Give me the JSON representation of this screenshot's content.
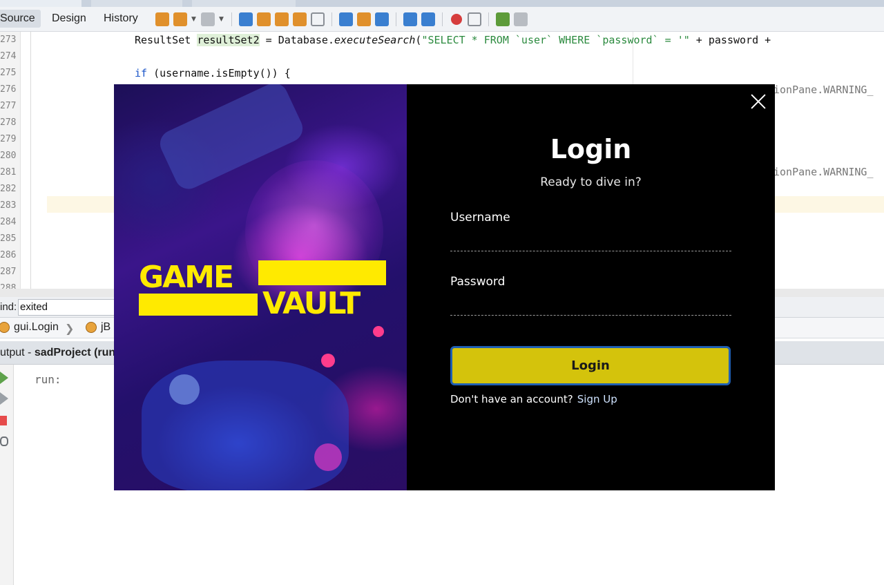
{
  "ide": {
    "tabs": [
      "Source",
      "Design",
      "History"
    ],
    "editor": {
      "line_numbers": [
        "273",
        "274",
        "275",
        "276",
        "277",
        "278",
        "279",
        "280",
        "281",
        "282",
        "283",
        "284",
        "285",
        "286",
        "287",
        "288"
      ],
      "line_273": {
        "type": "ResultSet ",
        "var": "resultSet2",
        "assign": " = Database.",
        "method": "executeSearch",
        "open": "(",
        "str1": "\"SELECT * FROM `user` WHERE `password` = '\"",
        "rest": " + password +"
      },
      "line_275": {
        "kw": "if",
        "rest": " (username.isEmpty()) {"
      },
      "ghost_276": "ionPane.WARNING_",
      "ghost_281": "ionPane.WARNING_"
    },
    "find": {
      "label": "ind:",
      "value": "exited"
    },
    "navigator": {
      "item1": "gui.Login",
      "item2": "jB"
    },
    "output": {
      "prefix": "utput - ",
      "project": "sadProject (run",
      "text": "run:"
    }
  },
  "dialog": {
    "brand": {
      "word1": "GAME",
      "word2": "VAULT"
    },
    "title": "Login",
    "subtitle": "Ready to dive in?",
    "username_label": "Username",
    "username_value": "",
    "password_label": "Password",
    "password_value": "",
    "login_button": "Login",
    "signup_prompt": "Don't have an account?",
    "signup_link": "Sign Up",
    "colors": {
      "accent": "#d4c30c",
      "brand_yellow": "#ffea00",
      "button_border": "#1f5fb3",
      "background": "#000000"
    }
  }
}
